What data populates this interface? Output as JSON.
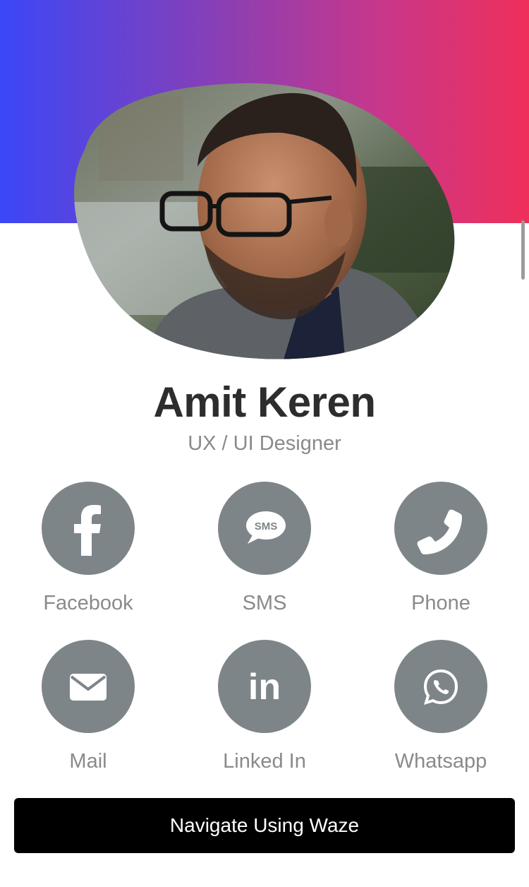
{
  "profile": {
    "name": "Amit Keren",
    "title": "UX / UI Designer"
  },
  "contacts": [
    {
      "label": "Facebook",
      "icon": "facebook-icon"
    },
    {
      "label": "SMS",
      "icon": "sms-icon",
      "icon_text": "SMS"
    },
    {
      "label": "Phone",
      "icon": "phone-icon"
    },
    {
      "label": "Mail",
      "icon": "mail-icon"
    },
    {
      "label": "Linked In",
      "icon": "linkedin-icon",
      "icon_text": "in"
    },
    {
      "label": "Whatsapp",
      "icon": "whatsapp-icon"
    }
  ],
  "actions": {
    "waze_label": "Navigate Using Waze"
  },
  "colors": {
    "gradient_start": "#3b47f7",
    "gradient_end": "#ef2f5a",
    "icon_circle": "#7e8589",
    "button_bg": "#000000",
    "name_text": "#2d2d2d",
    "muted_text": "#8a8a8a"
  }
}
